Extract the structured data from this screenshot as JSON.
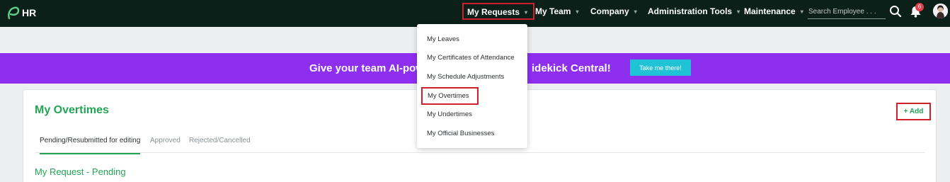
{
  "app": {
    "brand": "HR",
    "logo_icon": "leaf-logo-icon"
  },
  "nav": {
    "items": [
      {
        "label": "My Requests",
        "highlighted": true
      },
      {
        "label": "My Team"
      },
      {
        "label": "Company"
      },
      {
        "label": "Administration Tools"
      },
      {
        "label": "Maintenance"
      }
    ],
    "caret_icon": "chevron-down-icon",
    "search_placeholder": "Search Employee . . .",
    "search_icon": "search-icon",
    "bell_icon": "bell-icon",
    "notification_count": "6"
  },
  "dropdown": {
    "items": [
      {
        "label": "My Leaves"
      },
      {
        "label": "My Certificates of Attendance"
      },
      {
        "label": "My Schedule Adjustments"
      },
      {
        "label": "My Overtimes",
        "highlighted": true
      },
      {
        "label": "My Undertimes"
      },
      {
        "label": "My Official Businesses"
      }
    ]
  },
  "banner": {
    "text_left": "Give your team AI-pow",
    "text_right": "idekick Central!",
    "button": "Take me there!"
  },
  "card": {
    "title": "My Overtimes",
    "add_button": "+ Add",
    "tabs": [
      "Pending/Resubmitted for editing",
      "Approved",
      "Rejected/Cancelled"
    ],
    "section_title": "My Request - Pending"
  },
  "colors": {
    "topbar": "#0b2018",
    "banner": "#8e2ff0",
    "banner_button": "#20c3d6",
    "accent_green": "#23a455",
    "highlight_red": "#d0202b"
  }
}
